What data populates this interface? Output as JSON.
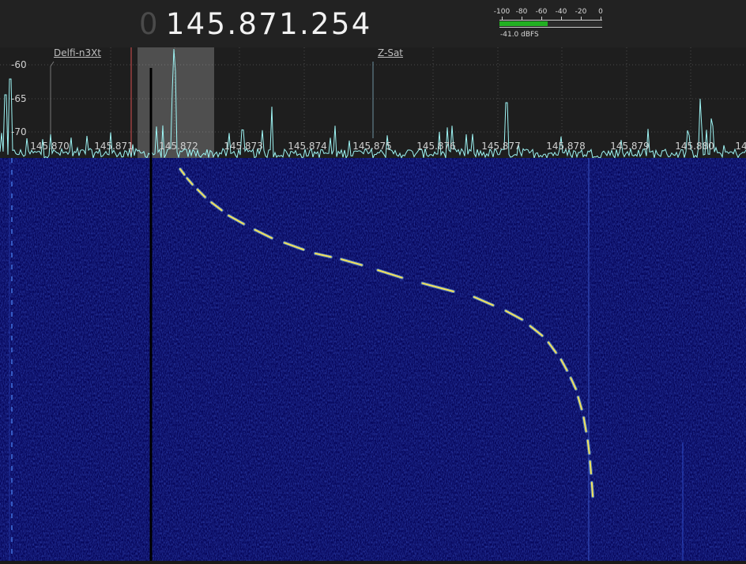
{
  "frequency_display": {
    "leading_digit": "0",
    "value": "145.871.254"
  },
  "level_meter": {
    "tick_labels": [
      "-100",
      "-80",
      "-60",
      "-40",
      "-20",
      "0"
    ],
    "level_dbfs": -41.0,
    "readout": "-41.0 dBFS",
    "fill_color": "#22b022"
  },
  "spectrum": {
    "db_labels": [
      "-60",
      "-65",
      "-70"
    ],
    "freq_labels": [
      "145.870",
      "145.871",
      "145.872",
      "145.873",
      "145.874",
      "145.875",
      "145.876",
      "145.877",
      "145.878",
      "145.879",
      "145.880",
      "14"
    ],
    "trace_color": "#9ef5f5",
    "bookmarks": [
      {
        "label": "Delfi-n3Xt"
      },
      {
        "label": "Z-Sat"
      }
    ]
  },
  "waterfall": {
    "background_color": "#07075e",
    "signal_color": "#f2e25c",
    "signal_glow_color": "#86c8f0"
  }
}
